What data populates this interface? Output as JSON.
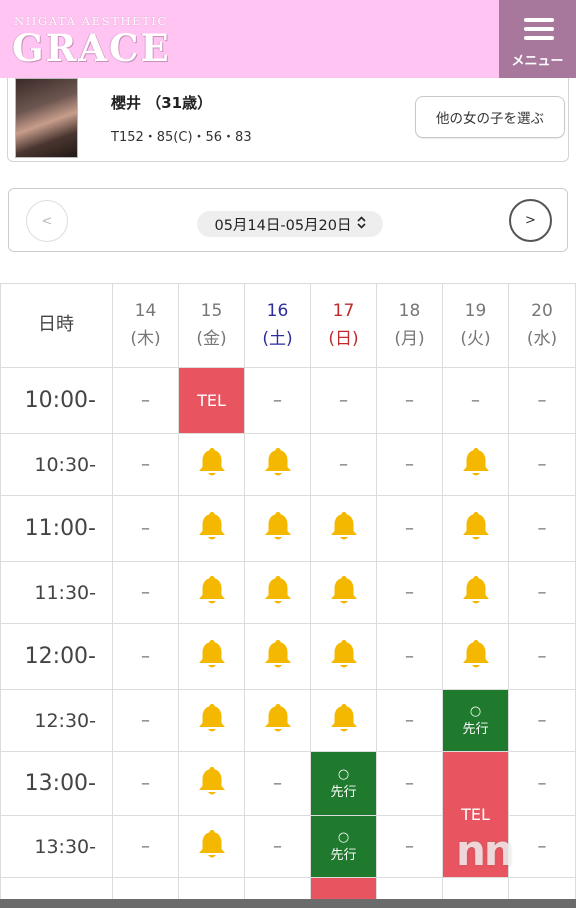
{
  "header": {
    "logo_sub": "NIIGATA AESTHETIC",
    "logo_main": "GRACE",
    "menu_label": "メニュー",
    "menu_icon": "hamburger-icon",
    "bg_color": "#ffc4f2",
    "menu_bg_color": "#a7779c"
  },
  "profile": {
    "name": "櫻井 （31歳）",
    "stats": "T152・85(C)・56・83",
    "other_button": "他の女の子を選ぶ"
  },
  "week": {
    "prev_label": "<",
    "next_label": ">",
    "range": "05月14日-05月20日",
    "caret": "⌃⌄"
  },
  "schedule": {
    "corner_label": "日時",
    "days": [
      {
        "date": "14",
        "dow": "(木)",
        "kind": "weekday"
      },
      {
        "date": "15",
        "dow": "(金)",
        "kind": "weekday"
      },
      {
        "date": "16",
        "dow": "(土)",
        "kind": "sat"
      },
      {
        "date": "17",
        "dow": "(日)",
        "kind": "sun"
      },
      {
        "date": "18",
        "dow": "(月)",
        "kind": "weekday"
      },
      {
        "date": "19",
        "dow": "(火)",
        "kind": "weekday"
      },
      {
        "date": "20",
        "dow": "(水)",
        "kind": "weekday"
      }
    ],
    "rows": [
      {
        "time": "10:00-",
        "cells": [
          "dash",
          "tel",
          "dash",
          "dash",
          "dash",
          "dash",
          "dash"
        ]
      },
      {
        "time": "10:30-",
        "cells": [
          "dash",
          "bell",
          "bell",
          "dash",
          "dash",
          "bell",
          "dash"
        ]
      },
      {
        "time": "11:00-",
        "cells": [
          "dash",
          "bell",
          "bell",
          "bell",
          "dash",
          "bell",
          "dash"
        ]
      },
      {
        "time": "11:30-",
        "cells": [
          "dash",
          "bell",
          "bell",
          "bell",
          "dash",
          "bell",
          "dash"
        ]
      },
      {
        "time": "12:00-",
        "cells": [
          "dash",
          "bell",
          "bell",
          "bell",
          "dash",
          "bell",
          "dash"
        ]
      },
      {
        "time": "12:30-",
        "cells": [
          "dash",
          "bell",
          "bell",
          "bell",
          "dash",
          "sen",
          "dash"
        ]
      },
      {
        "time": "13:00-",
        "cells": [
          "dash",
          "bell",
          "dash",
          "sen",
          "dash",
          "tel",
          "dash"
        ]
      },
      {
        "time": "13:30-",
        "cells": [
          "dash",
          "bell",
          "dash",
          "sen",
          "dash",
          "tel",
          "dash"
        ]
      },
      {
        "time": "",
        "cells": [
          "empty",
          "empty",
          "empty",
          "tel",
          "empty",
          "empty",
          "empty"
        ]
      }
    ],
    "labels": {
      "dash": "–",
      "tel": "TEL",
      "sen_circle": "○",
      "sen_text": "先行"
    },
    "colors": {
      "tel": "#e8545f",
      "sen": "#1f7a2e",
      "bell": "#f5b800",
      "sat": "#2d2d9c",
      "sun": "#c02a2a"
    }
  },
  "watermark": "nn"
}
